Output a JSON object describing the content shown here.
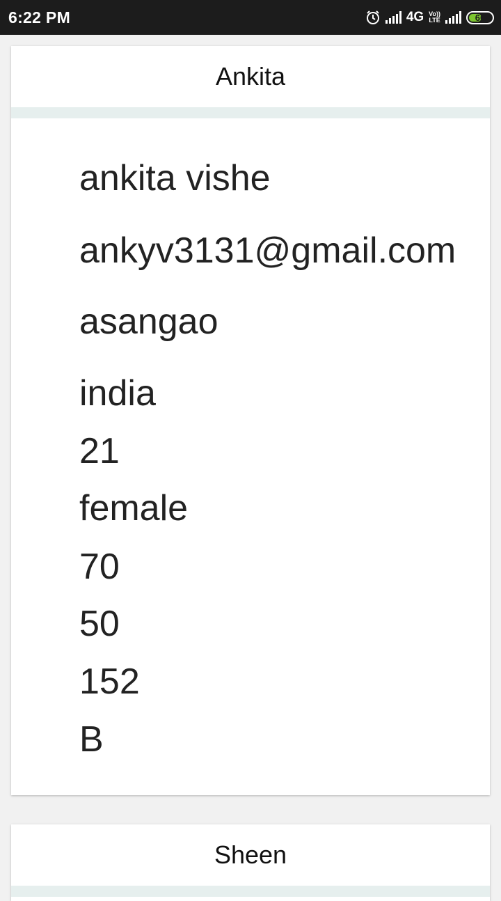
{
  "status_bar": {
    "time": "6:22 PM",
    "network": "4G",
    "volte_top": "Vo))",
    "volte_bottom": "LTE",
    "battery": "60",
    "battery_color": "#7dc62f"
  },
  "cards": [
    {
      "header": "Ankita",
      "fields": [
        "ankita vishe",
        "ankyv3131@gmail.com",
        "asangao",
        "india",
        "21",
        "female",
        "70",
        "50",
        "152",
        "B"
      ]
    },
    {
      "header": "Sheen"
    }
  ]
}
